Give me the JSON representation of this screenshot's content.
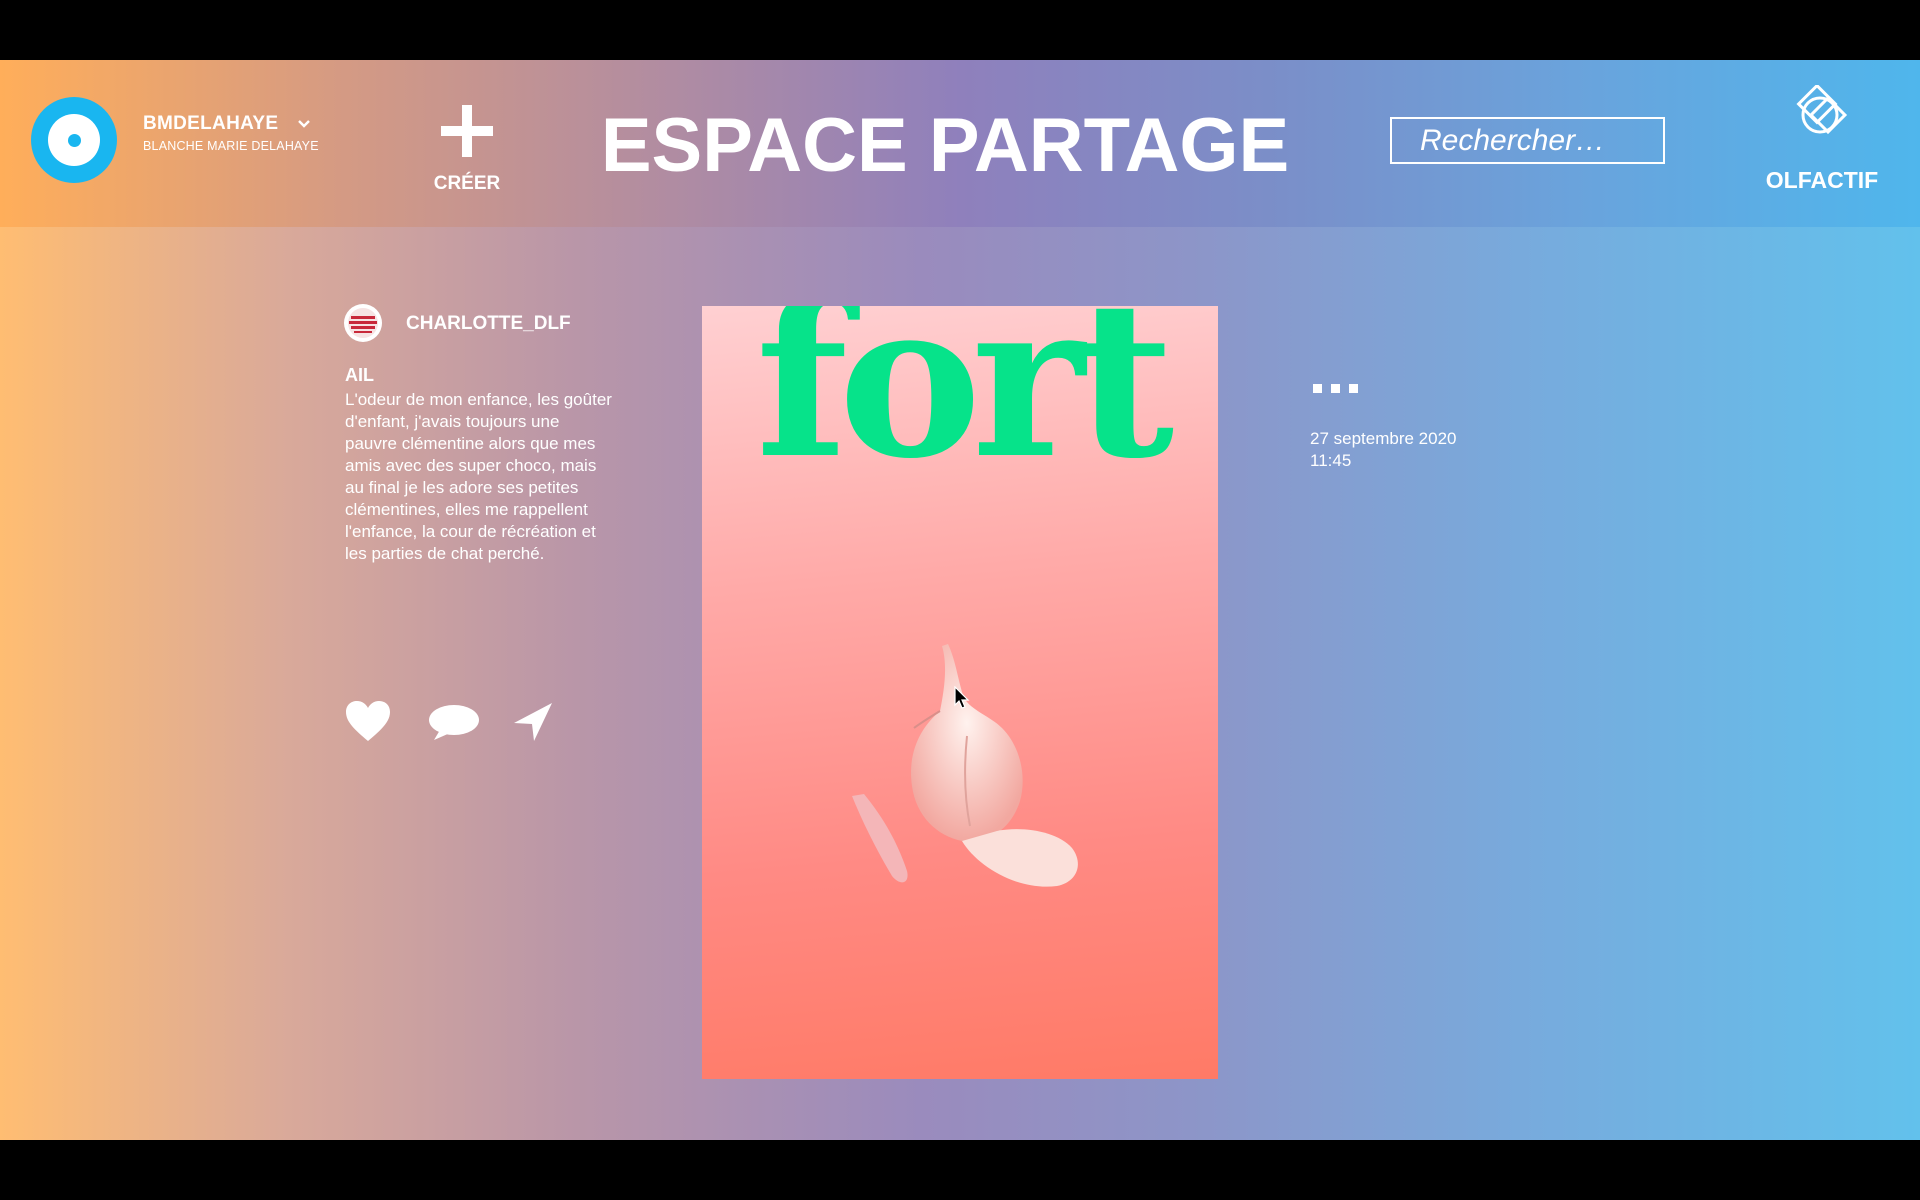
{
  "header": {
    "username": "BMDELAHAYE",
    "full_name": "BLANCHE MARIE DELAHAYE",
    "create_label": "CRÉER",
    "title": "ESPACE PARTAGE",
    "search_placeholder": "Rechercher…",
    "brand": "OLFACTIF"
  },
  "post": {
    "author": "CHARLOTTE_DLF",
    "title": "AIL",
    "body": "L'odeur de mon enfance, les goûter d'enfant, j'avais toujours une pauvre clémentine alors que mes amis avec des super choco, mais au final je les adore ses petites clémentines, elles me rappellent l'enfance, la cour de récréation et les parties de chat perché.",
    "image_word": "fort",
    "date": "27 septembre 2020",
    "time": "11:45"
  },
  "icons": {
    "avatar": "avatar-target-icon",
    "create": "plus-icon",
    "logo": "olfactif-logo-icon",
    "like": "heart-icon",
    "comment": "comment-icon",
    "share": "send-icon",
    "more": "more-dots-icon"
  },
  "colors": {
    "accent_blue": "#19b6f0",
    "image_word_green": "#06e38a",
    "text": "#ffffff"
  }
}
